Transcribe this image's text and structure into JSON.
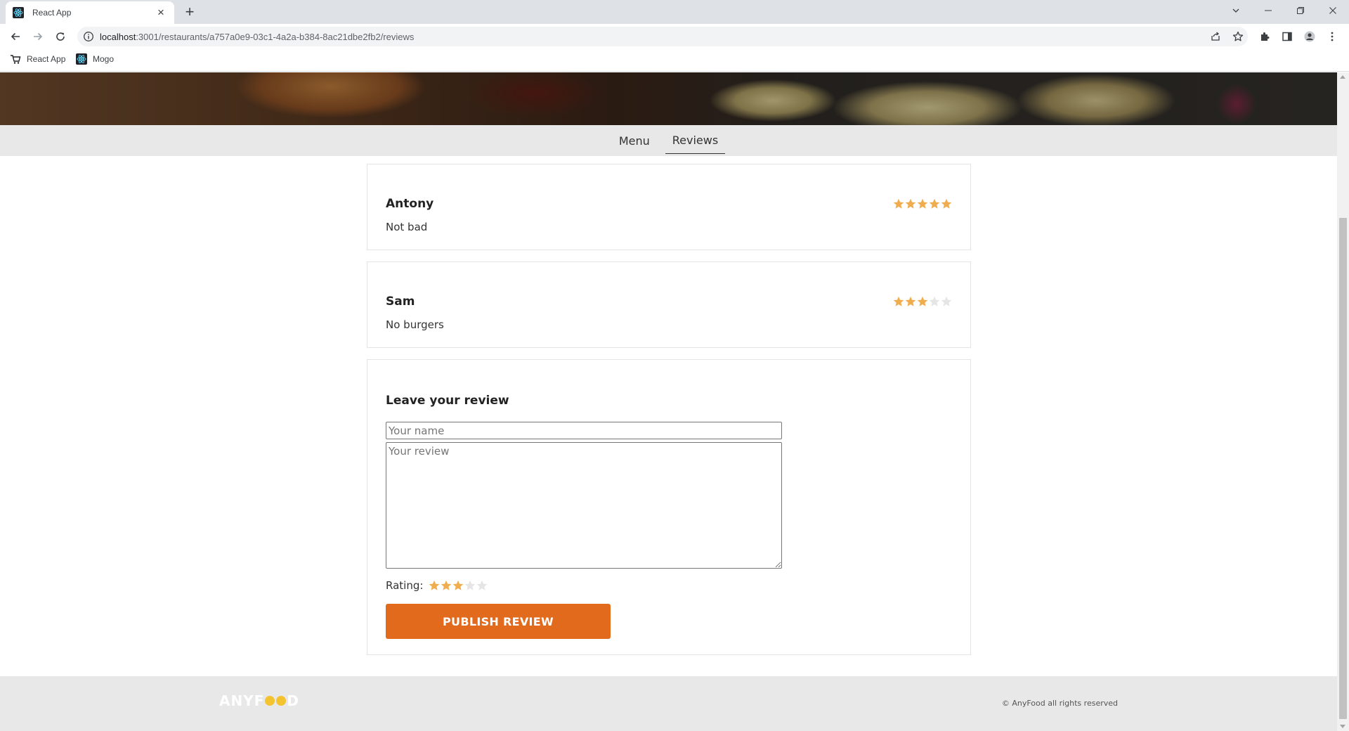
{
  "browser": {
    "tab_title": "React App",
    "url_host": "localhost",
    "url_path": ":3001/restaurants/a757a0e9-03c1-4a2a-b384-8ac21dbe2fb2/reviews",
    "bookmarks": [
      {
        "label": "React App",
        "icon": "react-app-bookmark-icon"
      },
      {
        "label": "Mogo",
        "icon": "react-logo-icon"
      }
    ]
  },
  "page": {
    "tabs": [
      "Menu",
      "Reviews"
    ],
    "active_tab": "Reviews",
    "reviews": [
      {
        "user": "Antony",
        "text": "Not bad",
        "rating": 5
      },
      {
        "user": "Sam",
        "text": "No burgers",
        "rating": 3
      }
    ],
    "form": {
      "title": "Leave your review",
      "name_placeholder": "Your name",
      "review_placeholder": "Your review",
      "rating_label": "Rating:",
      "rating": 3,
      "submit_label": "PUBLISH REVIEW"
    },
    "footer": {
      "logo_prefix": "ANYF",
      "logo_suffix": "D",
      "copyright": "© AnyFood all rights reserved"
    }
  },
  "colors": {
    "star_filled": "#f0ad4e",
    "star_empty": "#e5e5e5",
    "button": "#e26a1d"
  }
}
